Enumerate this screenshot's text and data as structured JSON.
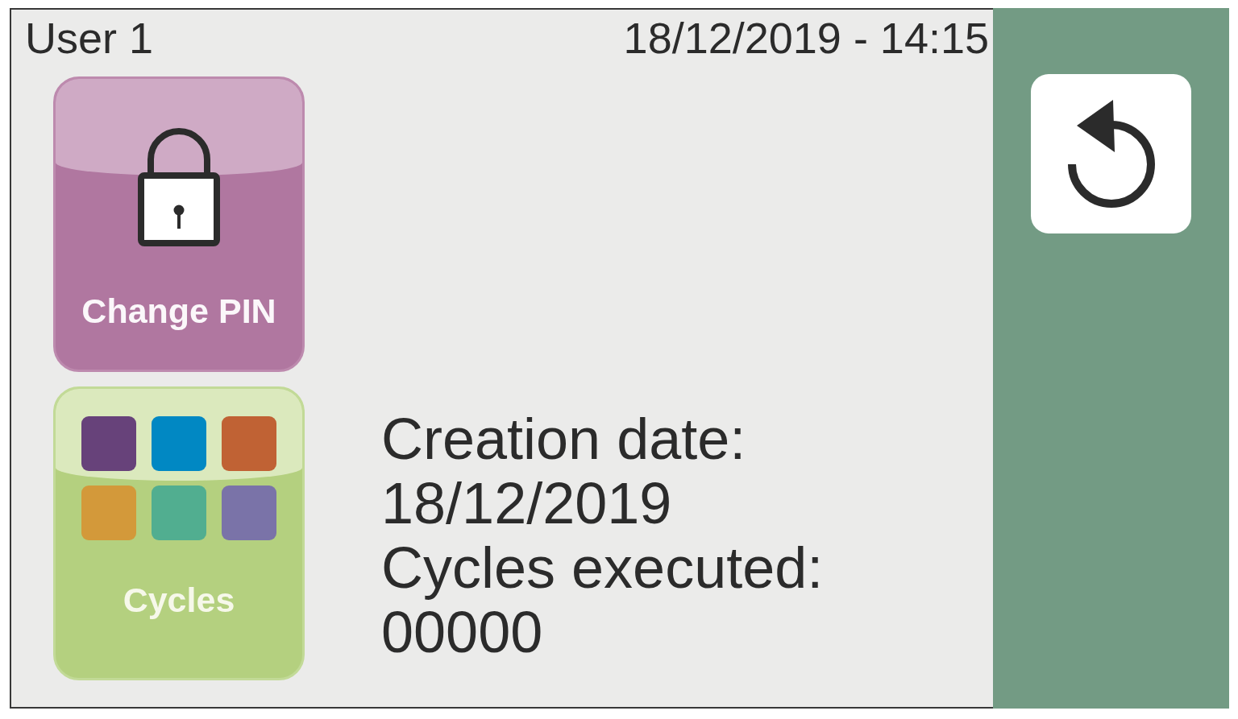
{
  "header": {
    "user": "User 1",
    "datetime": "18/12/2019 - 14:15"
  },
  "tiles": [
    {
      "kind": "pin",
      "label": "Change PIN"
    },
    {
      "kind": "cycles",
      "label": "Cycles"
    }
  ],
  "info": [
    {
      "label": "Creation date:",
      "value": "18/12/2019"
    },
    {
      "label": "Cycles executed:",
      "value": "00000"
    }
  ]
}
